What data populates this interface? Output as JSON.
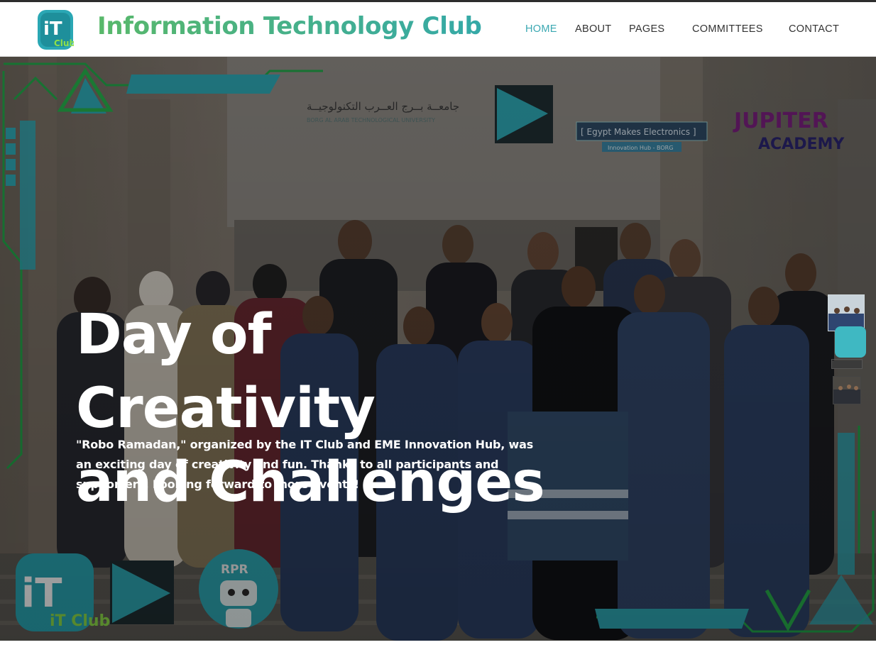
{
  "header": {
    "brand_title": "Information Technology Club",
    "logo_text": "iT Club"
  },
  "nav": {
    "items": [
      {
        "label": "HOME",
        "active": true
      },
      {
        "label": "ABOUT",
        "active": false
      },
      {
        "label": "PAGES",
        "active": false
      },
      {
        "label": "COMMITTEES",
        "active": false
      },
      {
        "label": "CONTACT",
        "active": false
      }
    ]
  },
  "hero": {
    "title_line1": "Day of Creativity",
    "title_line2": "and Challenges",
    "description": "\"Robo Ramadan,\" organized by the IT Club and EME Innovation Hub, was an exciting day of creativity and fun. Thanks to all participants and supporters. Looking forward to more events!",
    "building_sign_arabic": "جامعــة بــرج العــرب التكنولوجيــة",
    "building_sign_english": "BORG AL ARAB TECHNOLOGICAL UNIVERSITY",
    "banner_eme": "[ Egypt Makes Electronics ]",
    "banner_eme_sub": "Innovation Hub - BORG",
    "banner_jupiter_line1": "JUPITER",
    "banner_jupiter_line2": "ACADEMY",
    "badge_rpr": "RPR",
    "corner_logo_text": "iT Club"
  },
  "slider": {
    "active_index": 1,
    "count": 4
  },
  "colors": {
    "accent": "#3aa8b2",
    "brand_green": "#58b86a",
    "teal_shape": "#2fa8b5",
    "overlay": "#000000"
  }
}
